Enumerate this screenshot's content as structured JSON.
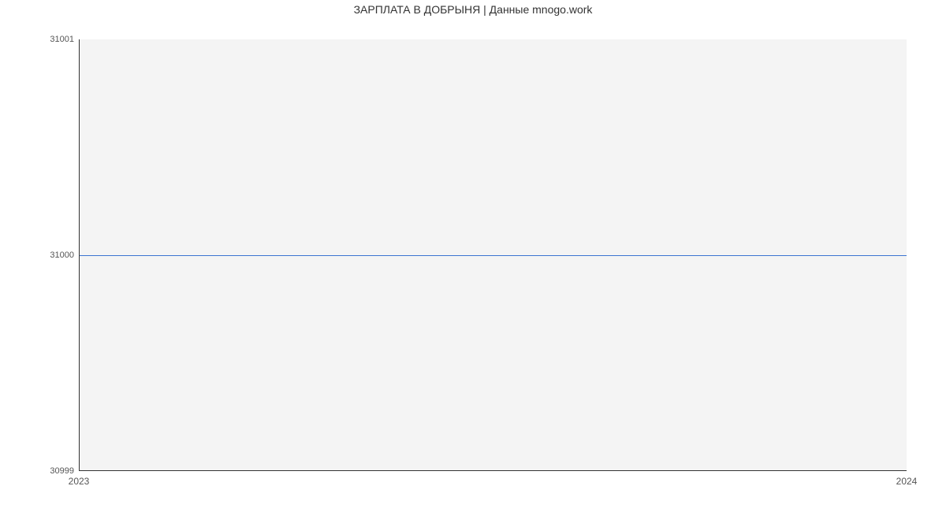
{
  "chart_data": {
    "type": "line",
    "title": "ЗАРПЛАТА В ДОБРЫНЯ | Данные mnogo.work",
    "xlabel": "",
    "ylabel": "",
    "x": [
      2023,
      2024
    ],
    "values": [
      31000,
      31000
    ],
    "x_ticks": [
      "2023",
      "2024"
    ],
    "y_ticks": [
      "30999",
      "31000",
      "31001"
    ],
    "xlim": [
      2023,
      2024
    ],
    "ylim": [
      30999,
      31001
    ],
    "line_color": "#3b74d1",
    "grid": false
  }
}
